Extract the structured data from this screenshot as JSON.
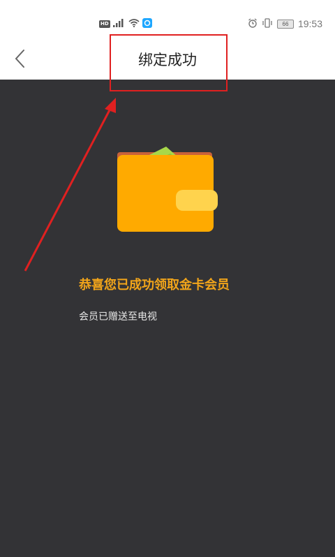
{
  "status_bar": {
    "network_badge": "HD",
    "time": "19:53",
    "battery_level": "66",
    "icons": [
      "signal-icon",
      "wifi-icon",
      "app-notification-icon",
      "alarm-icon",
      "vibrate-icon",
      "battery-icon"
    ]
  },
  "nav": {
    "title": "绑定成功",
    "back_icon": "chevron-left-icon"
  },
  "main": {
    "congrats_text": "恭喜您已成功领取金卡会员",
    "note_text": "会员已赠送至电视",
    "illustration": "wallet-icon"
  },
  "colors": {
    "content_bg": "#333336",
    "accent_gold": "#f2a51a",
    "wallet_orange": "#ffaa00",
    "annotation_red": "#e02020"
  }
}
